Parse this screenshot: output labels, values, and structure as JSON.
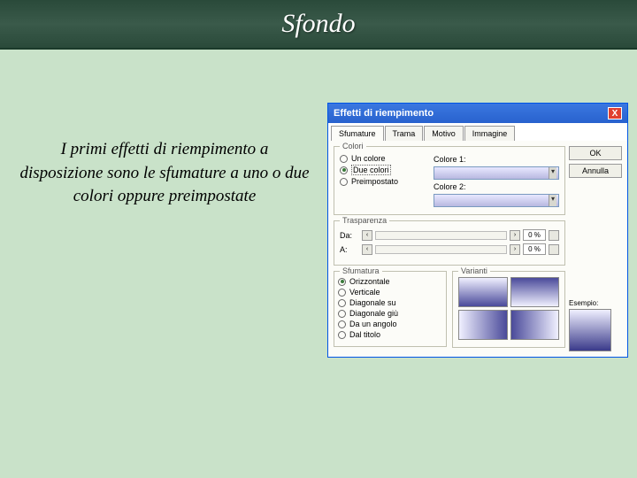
{
  "slide": {
    "title": "Sfondo",
    "description": "I primi effetti di riempimento a disposizione sono le sfumature a uno o due colori oppure preimpostate"
  },
  "dialog": {
    "title": "Effetti di riempimento",
    "close": "X",
    "tabs": [
      "Sfumature",
      "Trama",
      "Motivo",
      "Immagine"
    ],
    "buttons": {
      "ok": "OK",
      "cancel": "Annulla"
    },
    "colors": {
      "group": "Colori",
      "one": "Un colore",
      "two": "Due colori",
      "preset": "Preimpostato",
      "color1": "Colore 1:",
      "color2": "Colore 2:"
    },
    "transparency": {
      "group": "Trasparenza",
      "from": "Da:",
      "to": "A:",
      "pct": "0 %"
    },
    "shading": {
      "group": "Sfumatura",
      "horizontal": "Orizzontale",
      "vertical": "Verticale",
      "diagup": "Diagonale su",
      "diagdown": "Diagonale giù",
      "corner": "Da un angolo",
      "title": "Dal titolo"
    },
    "variants": {
      "group": "Varianti"
    },
    "sample": "Esempio:"
  }
}
